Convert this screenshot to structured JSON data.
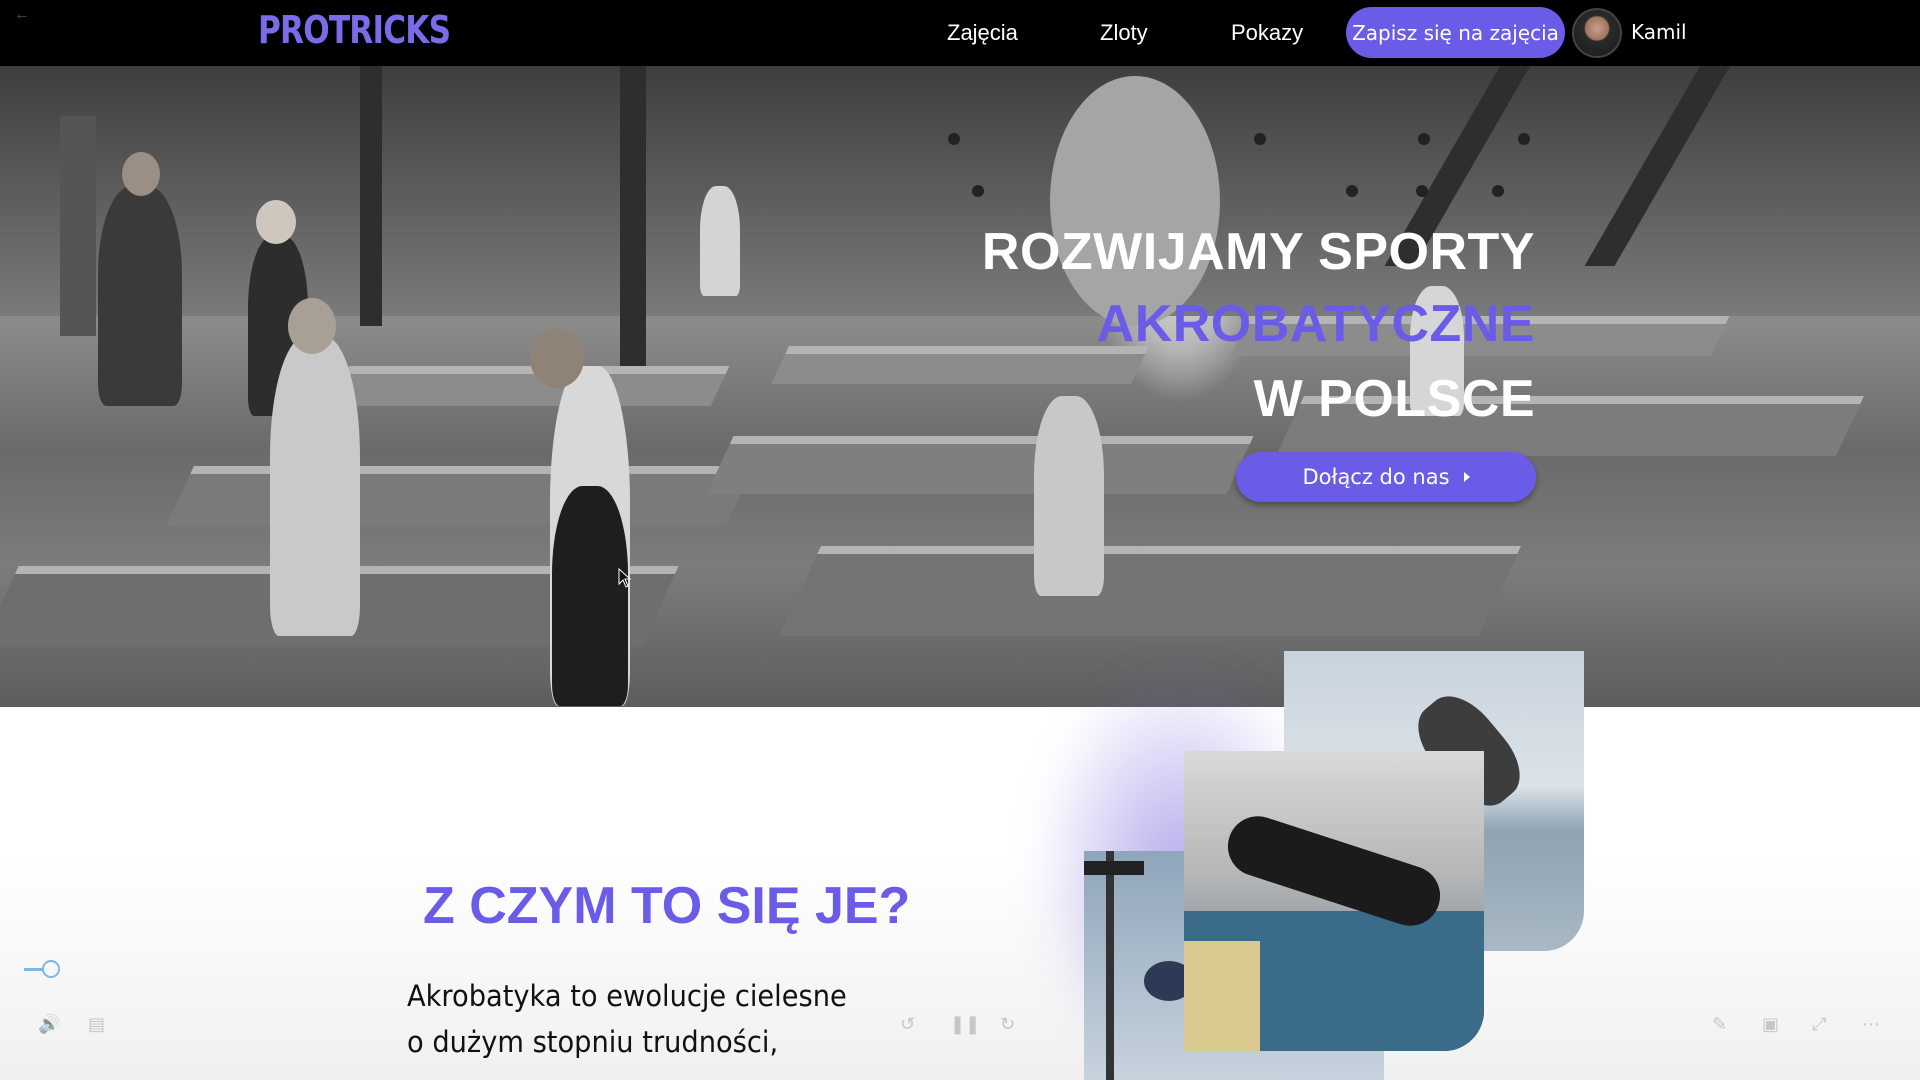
{
  "nav": {
    "logo": "PROTRICKS",
    "links": [
      "Zajęcia",
      "Zloty",
      "Pokazy"
    ],
    "cta": "Zapisz się na zajęcia",
    "user": "Kamil"
  },
  "hero": {
    "line1": "ROZWIJAMY SPORTY",
    "line2": "AKROBATYCZNE",
    "line3": "W POLSCE",
    "button": "Dołącz do nas"
  },
  "section": {
    "title": "Z CZYM TO SIĘ JE?",
    "paragraph_lines": [
      "Akrobatyka to ewolucje cielesne",
      "o dużym stopniu trudności,"
    ]
  },
  "icons": {
    "back": "arrow-left-icon",
    "button_arrow": "triangle-right-icon",
    "cursor": "mouse-cursor-icon"
  },
  "colors": {
    "accent": "#6b5ce7",
    "nav_bg": "#000000",
    "hero_text": "#ffffff"
  }
}
